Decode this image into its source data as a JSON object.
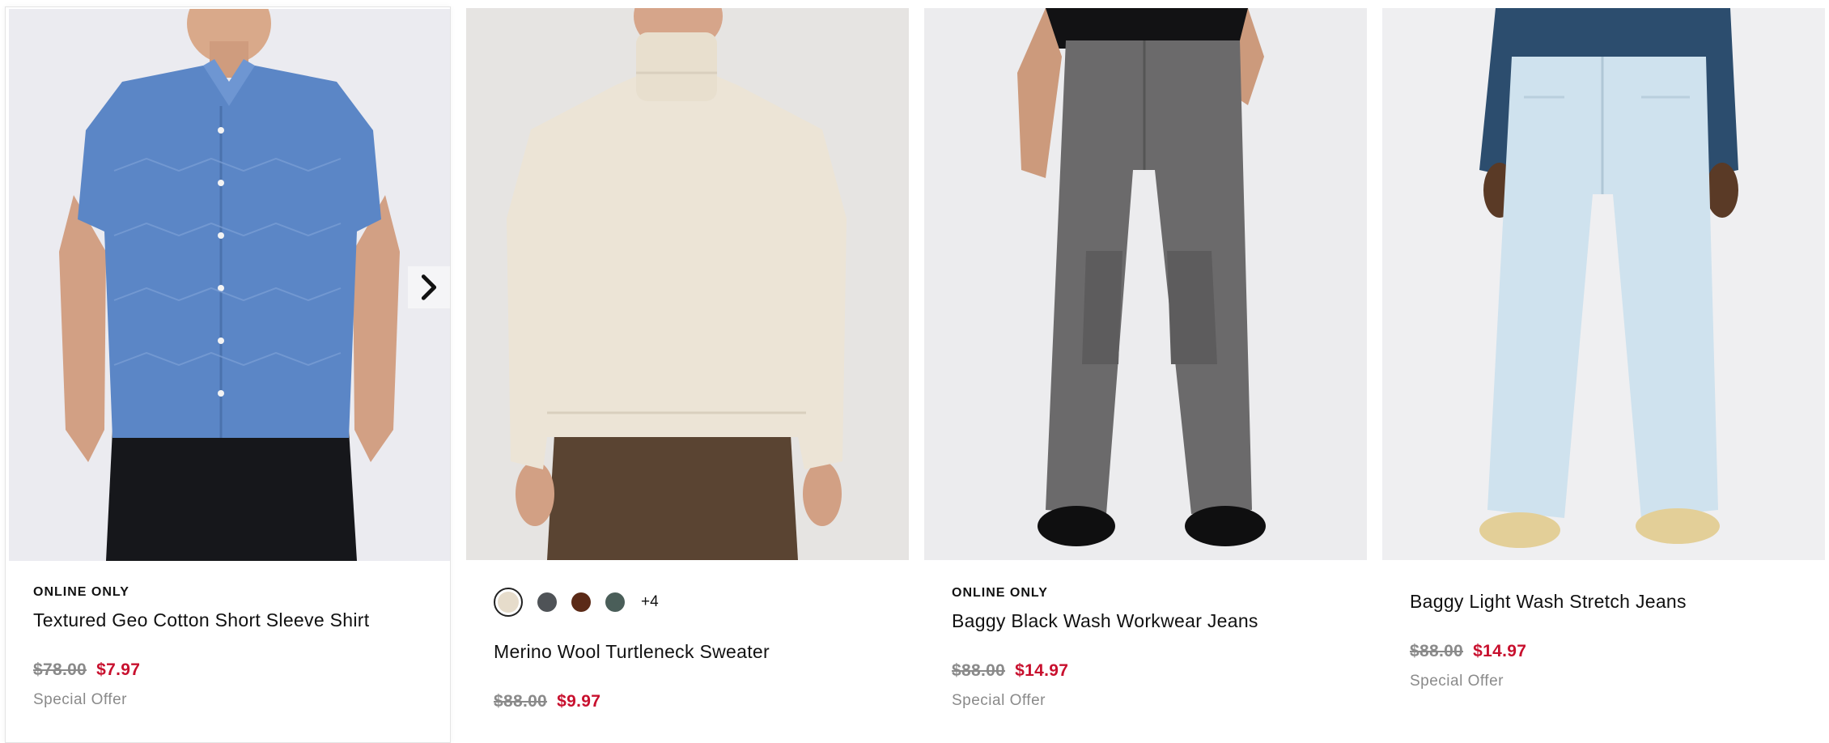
{
  "products": [
    {
      "badge": "ONLINE ONLY",
      "title": "Textured Geo Cotton Short Sleeve Shirt",
      "original_price": "$78.00",
      "sale_price": "$7.97",
      "offer": "Special Offer",
      "has_next_arrow": true
    },
    {
      "badge": "",
      "title": "Merino Wool Turtleneck Sweater",
      "original_price": "$88.00",
      "sale_price": "$9.97",
      "offer": "",
      "swatches": [
        {
          "name": "ivory",
          "color": "#e6dccb",
          "selected": true
        },
        {
          "name": "charcoal",
          "color": "#4f5357",
          "selected": false
        },
        {
          "name": "brown",
          "color": "#5b2a17",
          "selected": false
        },
        {
          "name": "green",
          "color": "#4a5e59",
          "selected": false
        }
      ],
      "more_colors": "+4"
    },
    {
      "badge": "ONLINE ONLY",
      "title": "Baggy Black Wash Workwear Jeans",
      "original_price": "$88.00",
      "sale_price": "$14.97",
      "offer": "Special Offer"
    },
    {
      "badge": "",
      "title": "Baggy Light Wash Stretch Jeans",
      "original_price": "$88.00",
      "sale_price": "$14.97",
      "offer": "Special Offer"
    }
  ],
  "colors": {
    "sale_red": "#c8102e",
    "muted_gray": "#8a8a8a"
  }
}
